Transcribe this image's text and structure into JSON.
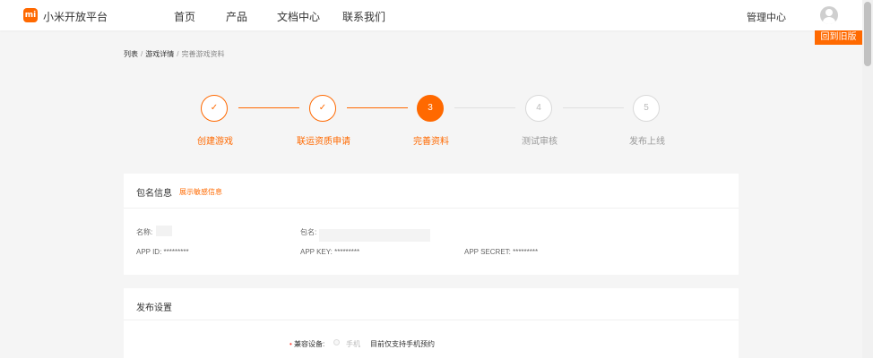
{
  "header": {
    "logo_text": "mi",
    "brand": "小米开放平台",
    "nav": [
      "首页",
      "产品",
      "文档中心",
      "联系我们"
    ],
    "admin": "管理中心",
    "old_version_button": "回到旧版"
  },
  "breadcrumb": {
    "items": [
      "列表",
      "游戏详情"
    ],
    "current": "完善游戏资料",
    "separator": "/"
  },
  "steps": [
    {
      "number": "✓",
      "label": "创建游戏",
      "state": "done"
    },
    {
      "number": "✓",
      "label": "联运资质申请",
      "state": "done"
    },
    {
      "number": "3",
      "label": "完善资料",
      "state": "active"
    },
    {
      "number": "4",
      "label": "测试审核",
      "state": "todo"
    },
    {
      "number": "5",
      "label": "发布上线",
      "state": "todo"
    }
  ],
  "package_card": {
    "title": "包名信息",
    "link": "展示敏感信息",
    "name_label": "名称:",
    "package_label": "包名:",
    "app_id": "APP ID: *********",
    "app_key": "APP KEY: *********",
    "app_secret": "APP SECRET: *********"
  },
  "publish_card": {
    "title": "发布设置",
    "required_mark": "•",
    "device_label": "兼容设备:",
    "device_option": "手机",
    "device_note": "目前仅支持手机预约"
  },
  "colors": {
    "accent": "#ff6900",
    "done_line": "#ff6900",
    "todo_line": "#e0e0e0"
  }
}
